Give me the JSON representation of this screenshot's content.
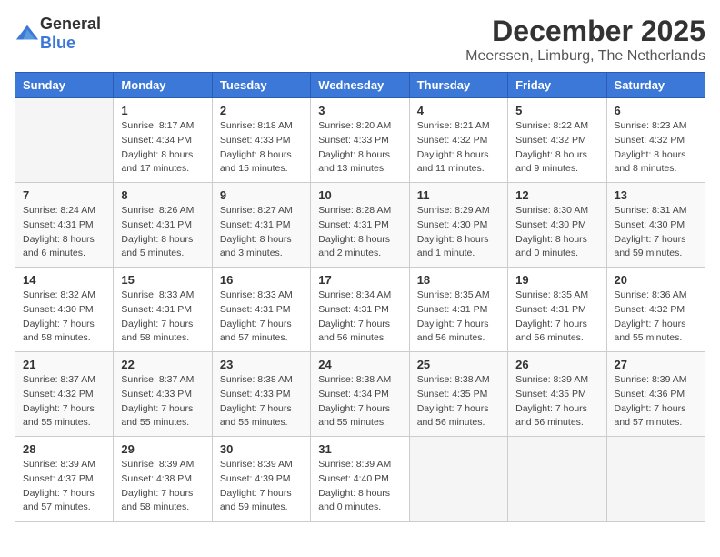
{
  "logo": {
    "general": "General",
    "blue": "Blue"
  },
  "title": "December 2025",
  "location": "Meerssen, Limburg, The Netherlands",
  "weekdays": [
    "Sunday",
    "Monday",
    "Tuesday",
    "Wednesday",
    "Thursday",
    "Friday",
    "Saturday"
  ],
  "weeks": [
    [
      {
        "day": "",
        "info": ""
      },
      {
        "day": "1",
        "info": "Sunrise: 8:17 AM\nSunset: 4:34 PM\nDaylight: 8 hours\nand 17 minutes."
      },
      {
        "day": "2",
        "info": "Sunrise: 8:18 AM\nSunset: 4:33 PM\nDaylight: 8 hours\nand 15 minutes."
      },
      {
        "day": "3",
        "info": "Sunrise: 8:20 AM\nSunset: 4:33 PM\nDaylight: 8 hours\nand 13 minutes."
      },
      {
        "day": "4",
        "info": "Sunrise: 8:21 AM\nSunset: 4:32 PM\nDaylight: 8 hours\nand 11 minutes."
      },
      {
        "day": "5",
        "info": "Sunrise: 8:22 AM\nSunset: 4:32 PM\nDaylight: 8 hours\nand 9 minutes."
      },
      {
        "day": "6",
        "info": "Sunrise: 8:23 AM\nSunset: 4:32 PM\nDaylight: 8 hours\nand 8 minutes."
      }
    ],
    [
      {
        "day": "7",
        "info": "Sunrise: 8:24 AM\nSunset: 4:31 PM\nDaylight: 8 hours\nand 6 minutes."
      },
      {
        "day": "8",
        "info": "Sunrise: 8:26 AM\nSunset: 4:31 PM\nDaylight: 8 hours\nand 5 minutes."
      },
      {
        "day": "9",
        "info": "Sunrise: 8:27 AM\nSunset: 4:31 PM\nDaylight: 8 hours\nand 3 minutes."
      },
      {
        "day": "10",
        "info": "Sunrise: 8:28 AM\nSunset: 4:31 PM\nDaylight: 8 hours\nand 2 minutes."
      },
      {
        "day": "11",
        "info": "Sunrise: 8:29 AM\nSunset: 4:30 PM\nDaylight: 8 hours\nand 1 minute."
      },
      {
        "day": "12",
        "info": "Sunrise: 8:30 AM\nSunset: 4:30 PM\nDaylight: 8 hours\nand 0 minutes."
      },
      {
        "day": "13",
        "info": "Sunrise: 8:31 AM\nSunset: 4:30 PM\nDaylight: 7 hours\nand 59 minutes."
      }
    ],
    [
      {
        "day": "14",
        "info": "Sunrise: 8:32 AM\nSunset: 4:30 PM\nDaylight: 7 hours\nand 58 minutes."
      },
      {
        "day": "15",
        "info": "Sunrise: 8:33 AM\nSunset: 4:31 PM\nDaylight: 7 hours\nand 58 minutes."
      },
      {
        "day": "16",
        "info": "Sunrise: 8:33 AM\nSunset: 4:31 PM\nDaylight: 7 hours\nand 57 minutes."
      },
      {
        "day": "17",
        "info": "Sunrise: 8:34 AM\nSunset: 4:31 PM\nDaylight: 7 hours\nand 56 minutes."
      },
      {
        "day": "18",
        "info": "Sunrise: 8:35 AM\nSunset: 4:31 PM\nDaylight: 7 hours\nand 56 minutes."
      },
      {
        "day": "19",
        "info": "Sunrise: 8:35 AM\nSunset: 4:31 PM\nDaylight: 7 hours\nand 56 minutes."
      },
      {
        "day": "20",
        "info": "Sunrise: 8:36 AM\nSunset: 4:32 PM\nDaylight: 7 hours\nand 55 minutes."
      }
    ],
    [
      {
        "day": "21",
        "info": "Sunrise: 8:37 AM\nSunset: 4:32 PM\nDaylight: 7 hours\nand 55 minutes."
      },
      {
        "day": "22",
        "info": "Sunrise: 8:37 AM\nSunset: 4:33 PM\nDaylight: 7 hours\nand 55 minutes."
      },
      {
        "day": "23",
        "info": "Sunrise: 8:38 AM\nSunset: 4:33 PM\nDaylight: 7 hours\nand 55 minutes."
      },
      {
        "day": "24",
        "info": "Sunrise: 8:38 AM\nSunset: 4:34 PM\nDaylight: 7 hours\nand 55 minutes."
      },
      {
        "day": "25",
        "info": "Sunrise: 8:38 AM\nSunset: 4:35 PM\nDaylight: 7 hours\nand 56 minutes."
      },
      {
        "day": "26",
        "info": "Sunrise: 8:39 AM\nSunset: 4:35 PM\nDaylight: 7 hours\nand 56 minutes."
      },
      {
        "day": "27",
        "info": "Sunrise: 8:39 AM\nSunset: 4:36 PM\nDaylight: 7 hours\nand 57 minutes."
      }
    ],
    [
      {
        "day": "28",
        "info": "Sunrise: 8:39 AM\nSunset: 4:37 PM\nDaylight: 7 hours\nand 57 minutes."
      },
      {
        "day": "29",
        "info": "Sunrise: 8:39 AM\nSunset: 4:38 PM\nDaylight: 7 hours\nand 58 minutes."
      },
      {
        "day": "30",
        "info": "Sunrise: 8:39 AM\nSunset: 4:39 PM\nDaylight: 7 hours\nand 59 minutes."
      },
      {
        "day": "31",
        "info": "Sunrise: 8:39 AM\nSunset: 4:40 PM\nDaylight: 8 hours\nand 0 minutes."
      },
      {
        "day": "",
        "info": ""
      },
      {
        "day": "",
        "info": ""
      },
      {
        "day": "",
        "info": ""
      }
    ]
  ]
}
